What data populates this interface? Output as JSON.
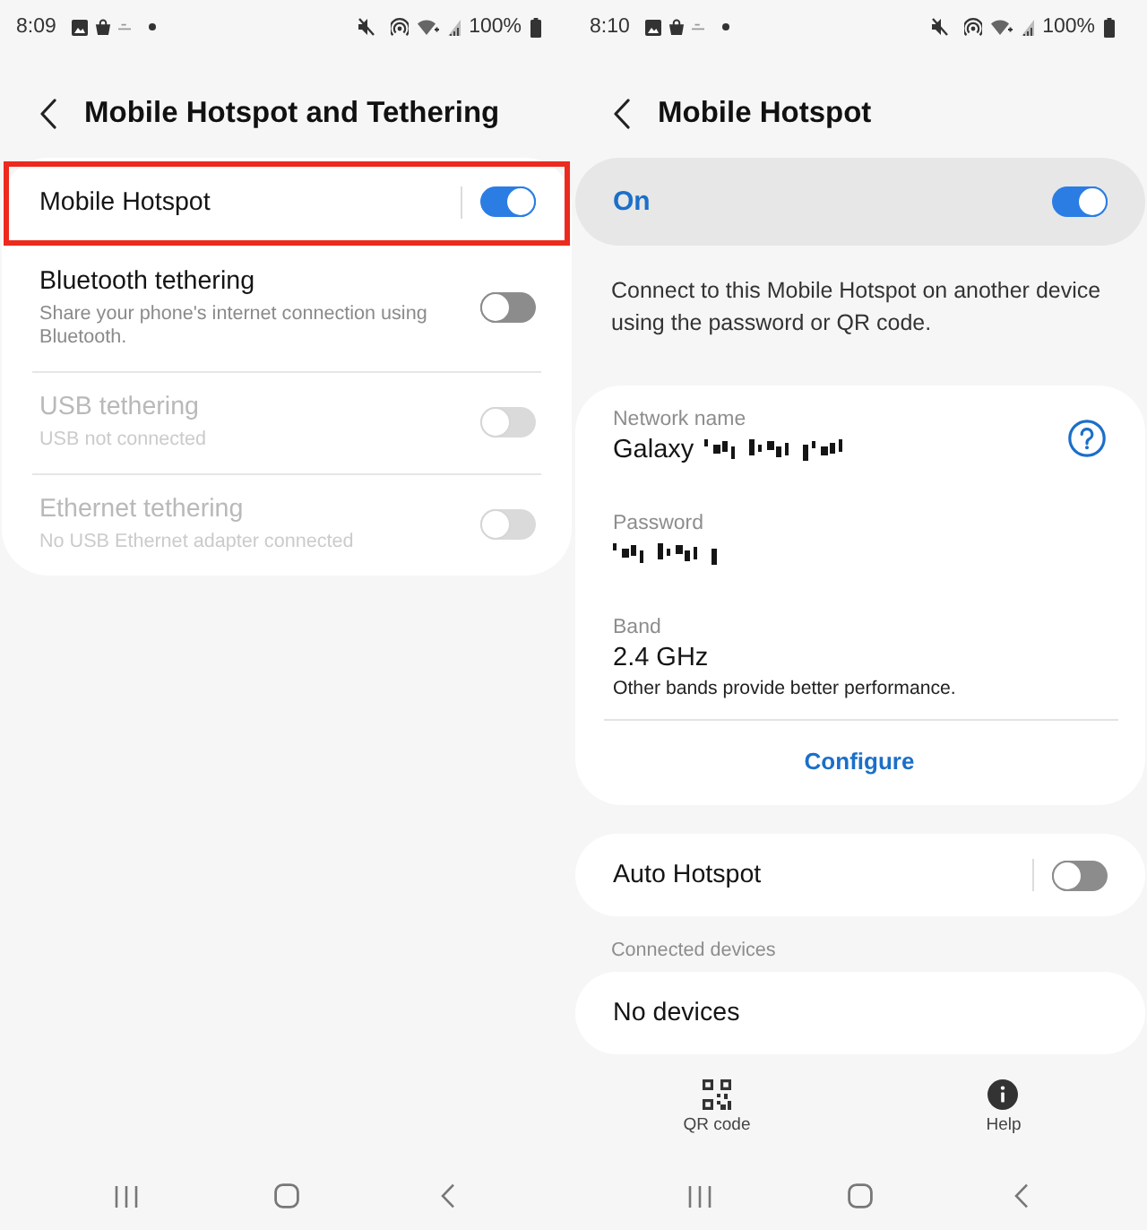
{
  "left_screen": {
    "status_bar": {
      "time": "8:09",
      "battery": "100%"
    },
    "header": {
      "title": "Mobile Hotspot and Tethering"
    },
    "settings": [
      {
        "kind": "split",
        "title": "Mobile Hotspot",
        "on": true,
        "disabled": false,
        "highlighted": true
      },
      {
        "kind": "switch",
        "title": "Bluetooth tethering",
        "subtitle": "Share your phone's internet connection using Bluetooth.",
        "on": false,
        "disabled": false,
        "highlighted": false
      },
      {
        "kind": "switch",
        "title": "USB tethering",
        "subtitle": "USB not connected",
        "on": false,
        "disabled": true,
        "highlighted": false
      },
      {
        "kind": "switch",
        "title": "Ethernet tethering",
        "subtitle": "No USB Ethernet adapter connected",
        "on": false,
        "disabled": true,
        "highlighted": false
      }
    ]
  },
  "right_screen": {
    "status_bar": {
      "time": "8:10",
      "battery": "100%"
    },
    "header": {
      "title": "Mobile Hotspot"
    },
    "master_switch": {
      "label": "On",
      "on": true
    },
    "description": "Connect to this Mobile Hotspot on another device using the password or QR code.",
    "details": [
      {
        "kind": "network",
        "label": "Network name",
        "value": "Galaxy",
        "obscured": true
      },
      {
        "kind": "password",
        "label": "Password",
        "obscured": true
      },
      {
        "kind": "band",
        "label": "Band",
        "value": "2.4 GHz",
        "note": "Other bands provide better performance."
      }
    ],
    "configure_button": "Configure",
    "auto_hotspot": {
      "label": "Auto Hotspot",
      "on": false
    },
    "connected_devices": {
      "heading": "Connected devices",
      "empty_text": "No devices"
    },
    "bottom_actions": [
      {
        "kind": "qr_code",
        "label": "QR code"
      },
      {
        "kind": "help",
        "label": "Help"
      }
    ]
  }
}
